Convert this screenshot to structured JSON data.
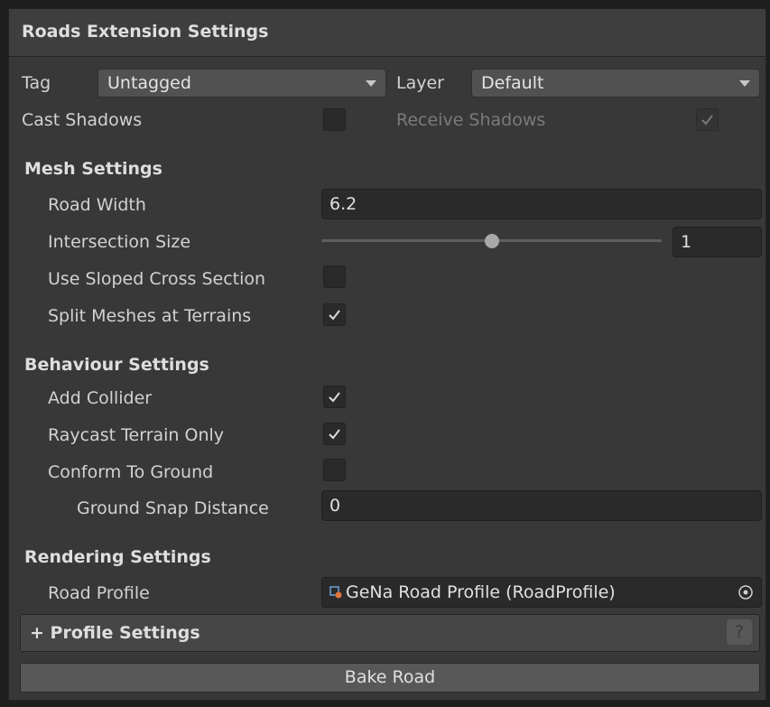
{
  "header": {
    "title": "Roads Extension Settings"
  },
  "object": {
    "tag_label": "Tag",
    "tag_value": "Untagged",
    "layer_label": "Layer",
    "layer_value": "Default",
    "cast_shadows_label": "Cast Shadows",
    "cast_shadows": false,
    "receive_shadows_label": "Receive Shadows",
    "receive_shadows": true
  },
  "mesh": {
    "title": "Mesh Settings",
    "road_width_label": "Road Width",
    "road_width": "6.2",
    "intersection_size_label": "Intersection Size",
    "intersection_size": "1",
    "intersection_slider_fraction": 0.5,
    "sloped_label": "Use Sloped Cross Section",
    "sloped": false,
    "split_label": "Split Meshes at Terrains",
    "split": true
  },
  "behaviour": {
    "title": "Behaviour Settings",
    "collider_label": "Add Collider",
    "collider": true,
    "raycast_label": "Raycast Terrain Only",
    "raycast": true,
    "conform_label": "Conform To Ground",
    "conform": false,
    "snap_label": "Ground Snap Distance",
    "snap": "0"
  },
  "rendering": {
    "title": "Rendering Settings",
    "profile_label": "Road Profile",
    "profile_value": "GeNa Road Profile (RoadProfile)"
  },
  "profile_foldout": {
    "label": "+ Profile Settings",
    "help": "?"
  },
  "bake_button": "Bake Road",
  "colors": {
    "panel": "#383838",
    "field": "#2a2a2a",
    "accent_icon": "#e0743a"
  },
  "icons": [
    "dropdown-arrow-icon",
    "checkmark-icon",
    "road-profile-icon",
    "object-picker-icon",
    "help-icon"
  ]
}
